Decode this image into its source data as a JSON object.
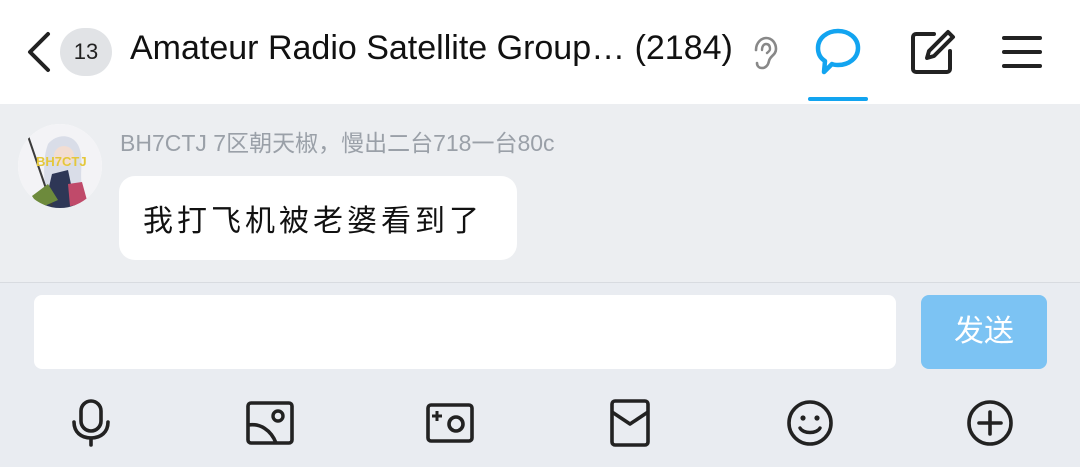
{
  "header": {
    "unread_count": "13",
    "title": "Amateur Radio Satellite Group… (2184)",
    "icons": [
      "back-arrow-icon",
      "ear-icon",
      "chat-bubble-icon",
      "edit-icon",
      "menu-icon"
    ],
    "accent_color": "#12a4f0"
  },
  "message": {
    "sender": "BH7CTJ 7区朝天椒，慢出二台718一台80c",
    "avatar_text": "BH7CTJ",
    "text": "我打飞机被老婆看到了"
  },
  "composer": {
    "input_value": "",
    "send_label": "发送",
    "send_color": "#7cc3f3",
    "tools": [
      "microphone-icon",
      "image-icon",
      "camera-icon",
      "red-packet-icon",
      "emoji-icon",
      "plus-icon"
    ]
  }
}
